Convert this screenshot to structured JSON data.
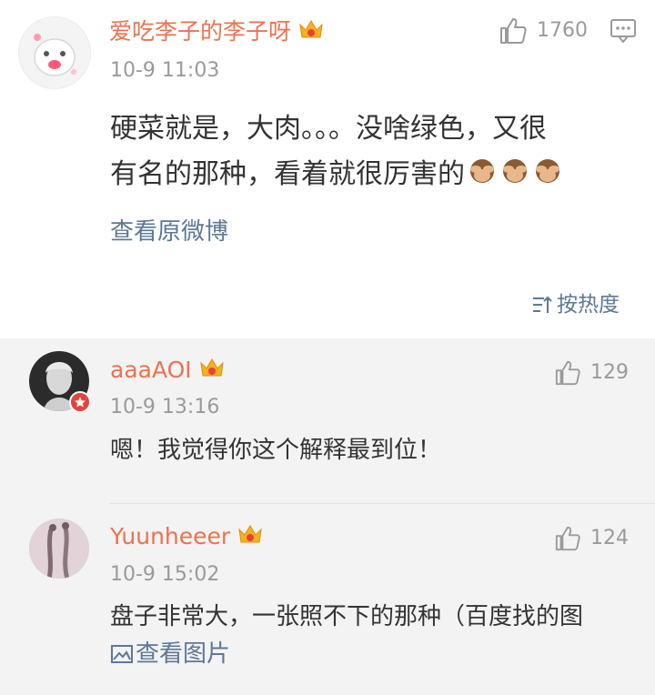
{
  "main_comment": {
    "username": "爱吃李子的李子呀",
    "timestamp": "10-9 11:03",
    "like_count": "1760",
    "text_line1": "硬菜就是，大肉。。。没啥绿色，又很",
    "text_line2": "有名的那种，看着就很厉害的",
    "text_emoji": "see-no-evil-monkey x3",
    "view_original": "查看原微博",
    "sort_label": "按热度",
    "avatar_icon": "cartoon-avatar",
    "crown_icon": "vip-crown-icon",
    "comment_icon": "comment-icon"
  },
  "replies": [
    {
      "username": "aaaAOI",
      "timestamp": "10-9 13:16",
      "like_count": "129",
      "text": "嗯！我觉得你这个解释最到位！"
    },
    {
      "username": "Yuunheeer",
      "timestamp": "10-9 15:02",
      "like_count": "124",
      "text": "盘子非常大，一张照不下的那种（百度找的图",
      "view_image": "查看图片"
    }
  ],
  "colors": {
    "username": "#eb7350",
    "link": "#5d7895",
    "meta": "#9a9a9a",
    "reply_bg": "#f3f3f3"
  }
}
